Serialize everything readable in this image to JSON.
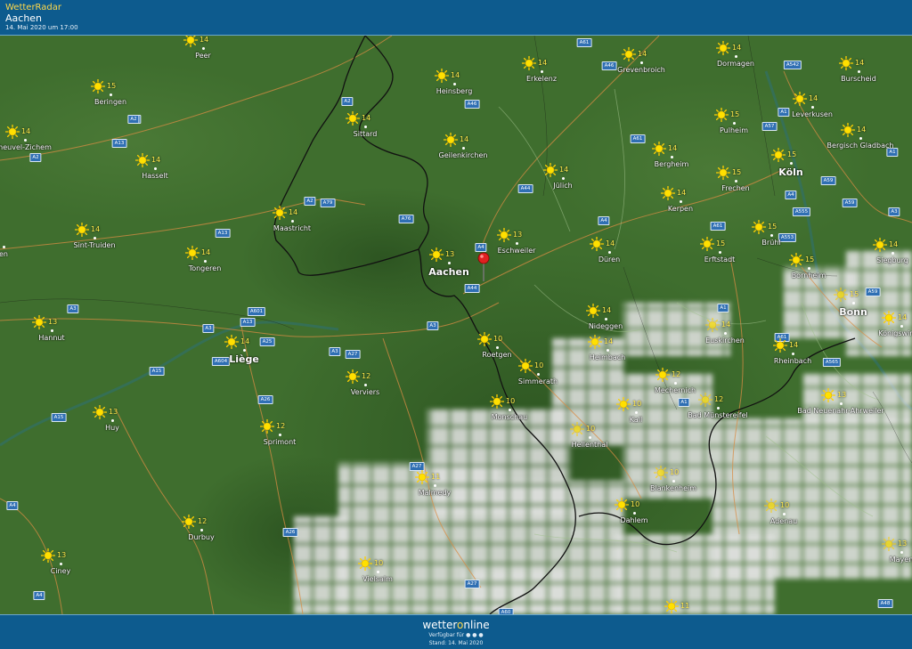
{
  "header": {
    "app_name": "WetterRadar",
    "location": "Aachen",
    "timestamp": "14. Mai 2020 um 17:00"
  },
  "footer": {
    "brand_prefix": "wetter",
    "brand_o": "o",
    "brand_suffix": "nline",
    "available_text": "Verfügbar für",
    "stand_text": "Stand: 14. Mai 2020"
  },
  "colors": {
    "header_bg": "#0d5b8e",
    "map_green": "#3c6a2c",
    "temperature": "#ffe84a",
    "road_shield": "#2f6fb3",
    "pin": "#e02020"
  },
  "cities": [
    {
      "name": "Peer",
      "temp": "14",
      "icon": "sun-icon"
    },
    {
      "name": "Beringen",
      "temp": "15",
      "icon": "sun-icon"
    },
    {
      "name": "Heusden-Zolder / Houthalen",
      "display": "heuvel-Zichem",
      "temp": "14",
      "icon": "sun-icon"
    },
    {
      "name": "Hasselt",
      "temp": "14",
      "icon": "sun-icon"
    },
    {
      "name": "Sint-Truiden",
      "temp": "14",
      "icon": "sun-icon"
    },
    {
      "name": "en",
      "temp": "",
      "icon": "sun-icon"
    },
    {
      "name": "Tongeren",
      "temp": "14",
      "icon": "sun-icon"
    },
    {
      "name": "Hannut",
      "temp": "13",
      "icon": "sun-icon"
    },
    {
      "name": "Liège",
      "temp": "14",
      "icon": "sun-icon"
    },
    {
      "name": "Huy",
      "temp": "13",
      "icon": "sun-icon"
    },
    {
      "name": "Durbuy",
      "temp": "12",
      "icon": "sun-icon"
    },
    {
      "name": "Ciney",
      "temp": "13",
      "icon": "sun-icon"
    },
    {
      "name": "Maastricht",
      "temp": "14",
      "icon": "sun-icon"
    },
    {
      "name": "Sittard",
      "temp": "14",
      "icon": "sun-icon"
    },
    {
      "name": "Heinsberg",
      "temp": "14",
      "icon": "sun-icon"
    },
    {
      "name": "Geilenkirchen",
      "temp": "14",
      "icon": "sun-icon"
    },
    {
      "name": "Erkelenz",
      "temp": "14",
      "icon": "sun-icon"
    },
    {
      "name": "Grevenbroich",
      "temp": "14",
      "icon": "sun-icon"
    },
    {
      "name": "Dormagen",
      "temp": "14",
      "icon": "sun-icon"
    },
    {
      "name": "Burscheid",
      "temp": "14",
      "icon": "sun-icon"
    },
    {
      "name": "Leverkusen",
      "temp": "14",
      "icon": "sun-icon"
    },
    {
      "name": "Pulheim",
      "temp": "15",
      "icon": "sun-icon"
    },
    {
      "name": "Bergisch Gladbach",
      "temp": "14",
      "icon": "sun-icon"
    },
    {
      "name": "Köln",
      "temp": "15",
      "icon": "sun-icon"
    },
    {
      "name": "Bergheim",
      "temp": "14",
      "icon": "sun-icon"
    },
    {
      "name": "Frechen",
      "temp": "15",
      "icon": "sun-icon"
    },
    {
      "name": "Jülich",
      "temp": "14",
      "icon": "sun-icon"
    },
    {
      "name": "Kerpen",
      "temp": "14",
      "icon": "sun-icon"
    },
    {
      "name": "Aachen",
      "temp": "13",
      "icon": "sun-icon"
    },
    {
      "name": "Eschweiler",
      "temp": "13",
      "icon": "sun-icon"
    },
    {
      "name": "Düren",
      "temp": "14",
      "icon": "sun-icon"
    },
    {
      "name": "Erftstadt",
      "temp": "15",
      "icon": "sun-icon"
    },
    {
      "name": "Brühl",
      "temp": "15",
      "icon": "sun-icon"
    },
    {
      "name": "Siegburg",
      "temp": "14",
      "icon": "sun-icon"
    },
    {
      "name": "Bornheim",
      "temp": "15",
      "icon": "sun-icon"
    },
    {
      "name": "Bonn",
      "temp": "15",
      "icon": "sun-icon"
    },
    {
      "name": "Königswinter",
      "temp": "14",
      "icon": "sun-icon"
    },
    {
      "name": "Nideggen",
      "temp": "14",
      "icon": "sun-icon"
    },
    {
      "name": "Euskirchen",
      "temp": "14",
      "icon": "sun-icon"
    },
    {
      "name": "Heimbach",
      "temp": "14",
      "icon": "sun-icon"
    },
    {
      "name": "Rheinbach",
      "temp": "14",
      "icon": "sun-icon"
    },
    {
      "name": "Roetgen",
      "temp": "10",
      "icon": "sun-icon"
    },
    {
      "name": "Simmerath",
      "temp": "10",
      "icon": "sun-icon"
    },
    {
      "name": "Verviers",
      "temp": "12",
      "icon": "sun-icon"
    },
    {
      "name": "Monschau",
      "temp": "10",
      "icon": "sun-icon"
    },
    {
      "name": "Mechernich",
      "temp": "12",
      "icon": "sun-icon"
    },
    {
      "name": "Bad Münstereifel",
      "temp": "12",
      "icon": "sun-icon"
    },
    {
      "name": "Bad Neuenahr-Ahrweiler",
      "temp": "13",
      "icon": "sun-icon"
    },
    {
      "name": "Kall",
      "temp": "10",
      "icon": "sun-icon"
    },
    {
      "name": "Hellenthal",
      "temp": "10",
      "icon": "sun-icon"
    },
    {
      "name": "Spa / Sprimont",
      "display": "Sprimont",
      "temp": "12",
      "icon": "sun-icon"
    },
    {
      "name": "Malmedy",
      "temp": "11",
      "icon": "sun-icon"
    },
    {
      "name": "Blankenheim",
      "temp": "10",
      "icon": "sun-icon"
    },
    {
      "name": "Dahlem",
      "temp": "10",
      "icon": "sun-icon"
    },
    {
      "name": "Adenau",
      "temp": "10",
      "icon": "sun-icon"
    },
    {
      "name": "Mayen",
      "temp": "13",
      "icon": "sun-icon"
    },
    {
      "name": "Vielsalm",
      "temp": "10",
      "icon": "sun-icon"
    },
    {
      "name": "",
      "temp": "11",
      "icon": "sun-icon"
    }
  ],
  "roads": [
    "A2",
    "A2",
    "A13",
    "A2",
    "A13",
    "A3",
    "A13",
    "A601",
    "A3",
    "A604",
    "A25",
    "A15",
    "A15",
    "A3",
    "A27",
    "A26",
    "A26",
    "A4",
    "A4",
    "A2",
    "A2",
    "A79",
    "A76",
    "A4",
    "A44",
    "A46",
    "A61",
    "A46",
    "A61",
    "A44",
    "A4",
    "A61",
    "A542",
    "A1",
    "A57",
    "A1",
    "A4",
    "A59",
    "A555",
    "A59",
    "A3",
    "A61",
    "A553",
    "A59",
    "A1",
    "A61",
    "A1",
    "A565",
    "A3",
    "A27",
    "A27",
    "A60",
    "A48",
    "A26"
  ]
}
